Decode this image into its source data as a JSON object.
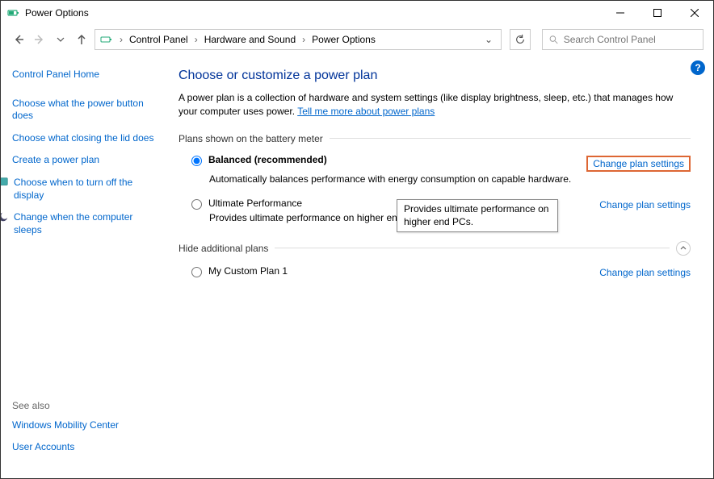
{
  "window": {
    "title": "Power Options"
  },
  "breadcrumbs": {
    "root": "Control Panel",
    "mid": "Hardware and Sound",
    "leaf": "Power Options"
  },
  "search": {
    "placeholder": "Search Control Panel"
  },
  "sidebar": {
    "home": "Control Panel Home",
    "link1": "Choose what the power button does",
    "link2": "Choose what closing the lid does",
    "link3": "Create a power plan",
    "link4": "Choose when to turn off the display",
    "link5": "Change when the computer sleeps"
  },
  "see_also": {
    "heading": "See also",
    "link1": "Windows Mobility Center",
    "link2": "User Accounts"
  },
  "main": {
    "heading": "Choose or customize a power plan",
    "intro_pre": "A power plan is a collection of hardware and system settings (like display brightness, sleep, etc.) that manages how your computer uses power. ",
    "intro_link": "Tell me more about power plans",
    "plans_label": "Plans shown on the battery meter",
    "hide_label": "Hide additional plans",
    "change_link": "Change plan settings",
    "plans": [
      {
        "name": "Balanced (recommended)",
        "desc": "Automatically balances performance with energy consumption on capable hardware.",
        "selected": true
      },
      {
        "name": "Ultimate Performance",
        "desc": "Provides ultimate performance on higher en",
        "selected": false
      }
    ],
    "additional": [
      {
        "name": "My Custom Plan 1",
        "selected": false
      }
    ],
    "tooltip": "Provides ultimate performance on higher end PCs."
  }
}
